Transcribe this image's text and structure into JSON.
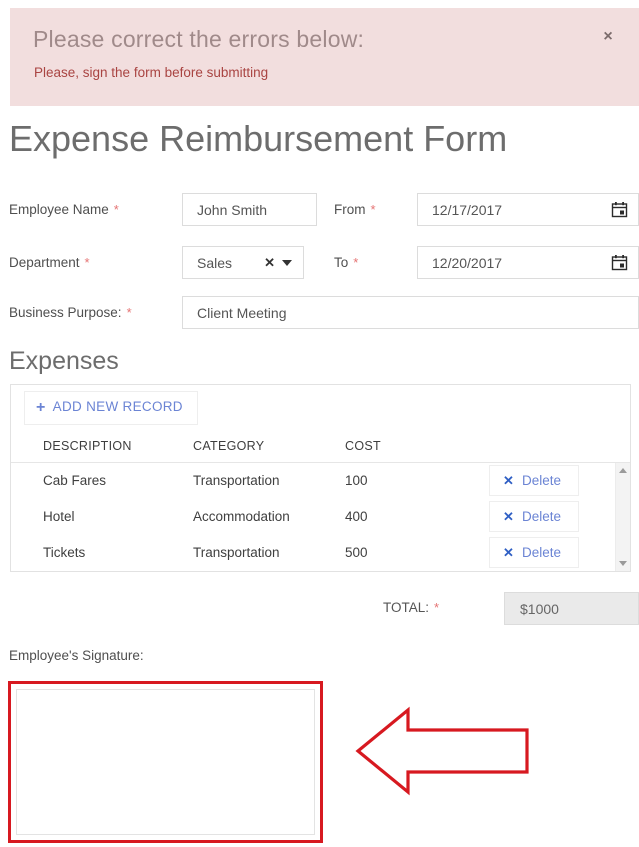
{
  "alert": {
    "title": "Please correct the errors below:",
    "message": "Please, sign the form before submitting",
    "close_label": "×",
    "bg_color": "#f2dede",
    "title_color": "#a08a8a",
    "message_color": "#a94442"
  },
  "page": {
    "title": "Expense Reimbursement Form",
    "required_marker": "*"
  },
  "form": {
    "employee_name": {
      "label": "Employee Name",
      "required": "*",
      "value": "John Smith"
    },
    "department": {
      "label": "Department",
      "required": "*",
      "value": "Sales",
      "clear_label": "✕"
    },
    "business_purpose": {
      "label": "Business Purpose:",
      "required": "*",
      "value": "Client Meeting"
    },
    "from_date": {
      "label": "From",
      "required": "*",
      "value": "12/17/2017"
    },
    "to_date": {
      "label": "To",
      "required": "*",
      "value": "12/20/2017"
    }
  },
  "expenses": {
    "section_title": "Expenses",
    "add_button": {
      "label": "ADD NEW RECORD",
      "plus": "+",
      "color": "#6b84d4"
    },
    "columns": [
      "DESCRIPTION",
      "CATEGORY",
      "COST"
    ],
    "rows": [
      {
        "description": "Cab Fares",
        "category": "Transportation",
        "cost": "100",
        "delete_label": "Delete",
        "delete_icon": "✕"
      },
      {
        "description": "Hotel",
        "category": "Accommodation",
        "cost": "400",
        "delete_label": "Delete",
        "delete_icon": "✕"
      },
      {
        "description": "Tickets",
        "category": "Transportation",
        "cost": "500",
        "delete_label": "Delete",
        "delete_icon": "✕"
      }
    ]
  },
  "total": {
    "label": "TOTAL:",
    "required": "*",
    "value": "$1000"
  },
  "signature": {
    "label": "Employee's Signature:",
    "value": "",
    "highlight_color": "#d71920"
  },
  "annotation": {
    "arrow_color": "#d71920",
    "direction": "left"
  }
}
